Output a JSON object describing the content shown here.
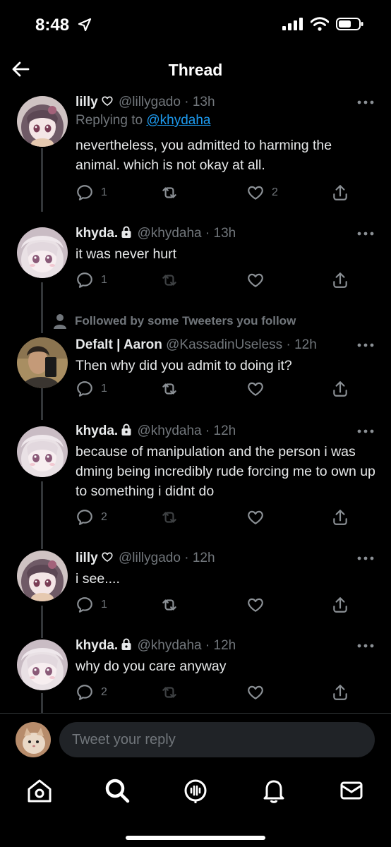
{
  "status_bar": {
    "time": "8:48"
  },
  "header": {
    "title": "Thread"
  },
  "tweets": [
    {
      "name": "lilly",
      "badge": "heart",
      "handle": "@lillygado",
      "sep": "·",
      "time": "13h",
      "replying_prefix": "Replying to",
      "replying_to": "@khydaha",
      "text": "nevertheless, you admitted to harming the animal. which is not okay at all.",
      "replies": "1",
      "retweets": "",
      "likes": "2",
      "avatar": "lilly-anime-avatar"
    },
    {
      "name": "khyda.",
      "badge": "lock",
      "handle": "@khydaha",
      "sep": "·",
      "time": "13h",
      "text": "it was never hurt",
      "replies": "1",
      "retweets": "",
      "likes": "",
      "avatar": "khyda-anime-avatar"
    },
    {
      "social_context": "Followed by some Tweeters you follow",
      "name": "Defalt | Aaron",
      "handle": "@KassadinUseless",
      "sep": "·",
      "time": "12h",
      "text": "Then why did you admit to doing it?",
      "replies": "1",
      "retweets": "",
      "likes": "",
      "avatar": "aaron-photo-avatar"
    },
    {
      "name": "khyda.",
      "badge": "lock",
      "handle": "@khydaha",
      "sep": "·",
      "time": "12h",
      "text": "because of manipulation and the person i was dming being incredibly rude forcing me to own up to something i didnt do",
      "replies": "2",
      "retweets": "",
      "likes": "",
      "avatar": "khyda-anime-avatar"
    },
    {
      "name": "lilly",
      "badge": "heart",
      "handle": "@lillygado",
      "sep": "·",
      "time": "12h",
      "text": "i see....",
      "replies": "1",
      "retweets": "",
      "likes": "",
      "avatar": "lilly-anime-avatar"
    },
    {
      "name": "khyda.",
      "badge": "lock",
      "handle": "@khydaha",
      "sep": "·",
      "time": "12h",
      "text": "why do you care anyway",
      "replies": "2",
      "retweets": "",
      "likes": "",
      "avatar": "khyda-anime-avatar"
    }
  ],
  "compose": {
    "placeholder": "Tweet your reply"
  },
  "tabbar": {
    "items": [
      "home-icon",
      "search-icon",
      "spaces-icon",
      "notifications-icon",
      "messages-icon"
    ]
  },
  "colors": {
    "accent": "#1d9bf0",
    "muted": "#71767b",
    "text": "#e7e9ea",
    "background": "#000000"
  }
}
